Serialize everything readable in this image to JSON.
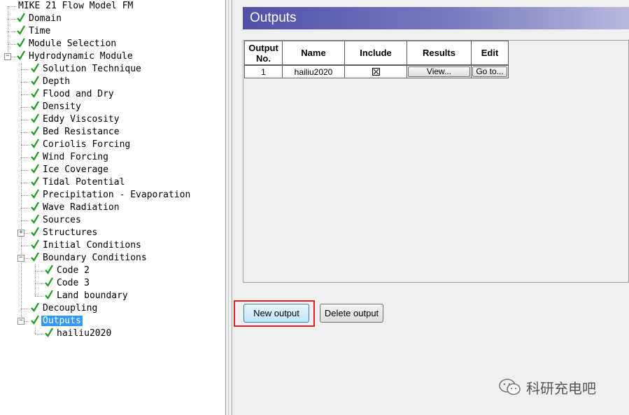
{
  "tree": {
    "nodes": [
      {
        "label": "MIKE 21 Flow Model FM",
        "checked": false
      },
      {
        "label": "Domain",
        "checked": true
      },
      {
        "label": "Time",
        "checked": true
      },
      {
        "label": "Module Selection",
        "checked": true
      },
      {
        "label": "Hydrodynamic Module",
        "checked": true,
        "expander": "minus"
      },
      {
        "label": "Solution Technique",
        "checked": true
      },
      {
        "label": "Depth",
        "checked": true
      },
      {
        "label": "Flood and Dry",
        "checked": true
      },
      {
        "label": "Density",
        "checked": true
      },
      {
        "label": "Eddy Viscosity",
        "checked": true
      },
      {
        "label": "Bed Resistance",
        "checked": true
      },
      {
        "label": "Coriolis Forcing",
        "checked": true
      },
      {
        "label": "Wind Forcing",
        "checked": true
      },
      {
        "label": "Ice Coverage",
        "checked": true
      },
      {
        "label": "Tidal Potential",
        "checked": true
      },
      {
        "label": "Precipitation - Evaporation",
        "checked": true
      },
      {
        "label": "Wave Radiation",
        "checked": true
      },
      {
        "label": "Sources",
        "checked": true
      },
      {
        "label": "Structures",
        "checked": true,
        "expander": "plus"
      },
      {
        "label": "Initial Conditions",
        "checked": true
      },
      {
        "label": "Boundary Conditions",
        "checked": true,
        "expander": "minus"
      },
      {
        "label": "Code 2",
        "checked": true
      },
      {
        "label": "Code 3",
        "checked": true
      },
      {
        "label": "Land boundary",
        "checked": true
      },
      {
        "label": "Decoupling",
        "checked": true
      },
      {
        "label": "Outputs",
        "checked": true,
        "expander": "minus",
        "selected": true
      },
      {
        "label": "hailiu2020",
        "checked": true
      }
    ],
    "check_color": "#1a9a1a",
    "selection_color": "#3399ff"
  },
  "panel": {
    "title": "Outputs",
    "grid": {
      "columns": [
        "Output No.",
        "Name",
        "Include",
        "Results",
        "Edit"
      ],
      "rows": [
        {
          "no": "1",
          "name": "hailiu2020",
          "include": true,
          "results_button": "View...",
          "edit_button": "Go to..."
        }
      ]
    },
    "buttons": {
      "new_output": "New output",
      "delete_output": "Delete output"
    },
    "highlight_color": "#e02020"
  },
  "watermark": {
    "text": "科研充电吧",
    "icon": "wechat-icon"
  }
}
